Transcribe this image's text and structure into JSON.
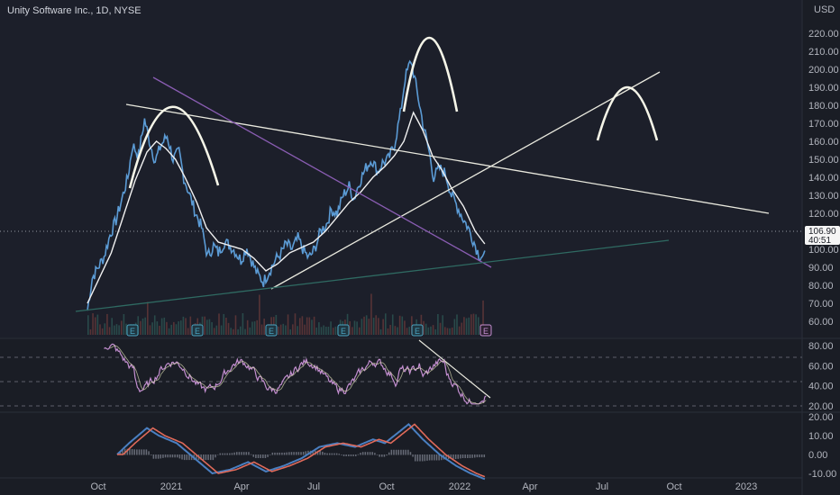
{
  "header": {
    "title": "Unity Software Inc., 1D, NYSE",
    "currency": "USD"
  },
  "colors": {
    "background": "#1a1d25",
    "price": "#5b9bd5",
    "ma": "#f0f0f0",
    "grid": "#2a2e39",
    "volume": "#6b3b3b",
    "rsi": "#c48fd1",
    "rsi_ma": "#e0d090",
    "macd": "#4a7fc1",
    "signal": "#e06a5a",
    "hist": "#7a7f8c",
    "annotation": "#f5f5e8",
    "channel_purple": "#8a5db3",
    "channel_teal": "#2f6a62",
    "last_price_bg": "#f5f5f5"
  },
  "price_axis": {
    "ticks": [
      "60.00",
      "70.00",
      "80.00",
      "90.00",
      "100.00",
      "110.00",
      "120.00",
      "130.00",
      "140.00",
      "150.00",
      "160.00",
      "170.00",
      "180.00",
      "190.00",
      "200.00",
      "210.00",
      "220.00"
    ]
  },
  "last_price": {
    "value": "106.90",
    "countdown": "40:51"
  },
  "rsi_axis": {
    "ticks": [
      "20.00",
      "40.00",
      "60.00",
      "80.00"
    ]
  },
  "macd_axis": {
    "ticks": [
      "-10.00",
      "0.00",
      "10.00",
      "20.00"
    ]
  },
  "time_axis": {
    "labels": [
      "Oct",
      "2021",
      "Apr",
      "Jul",
      "Oct",
      "2022",
      "Apr",
      "Jul",
      "Oct",
      "2023"
    ]
  },
  "earnings_markers": [
    "E",
    "E",
    "E",
    "E",
    "E",
    "E"
  ],
  "chart_data": {
    "type": "line",
    "title": "Unity Software Inc., 1D, NYSE",
    "ylabel": "USD",
    "ylim": [
      55,
      222
    ],
    "series": [
      {
        "values": [
          [
            0,
            66
          ],
          [
            4,
            84
          ],
          [
            9,
            90
          ],
          [
            14,
            96
          ],
          [
            19,
            108
          ],
          [
            24,
            116
          ],
          [
            29,
            128
          ],
          [
            34,
            140
          ],
          [
            38,
            158
          ],
          [
            43,
            152
          ],
          [
            48,
            172
          ],
          [
            53,
            158
          ],
          [
            57,
            149
          ],
          [
            62,
            158
          ],
          [
            67,
            163
          ],
          [
            72,
            150
          ],
          [
            77,
            154
          ],
          [
            81,
            140
          ],
          [
            86,
            130
          ],
          [
            91,
            120
          ],
          [
            96,
            112
          ],
          [
            101,
            96
          ],
          [
            106,
            102
          ],
          [
            110,
            98
          ],
          [
            115,
            104
          ],
          [
            120,
            102
          ],
          [
            124,
            99
          ],
          [
            129,
            94
          ],
          [
            134,
            101
          ],
          [
            139,
            92
          ],
          [
            143,
            86
          ],
          [
            148,
            82
          ],
          [
            153,
            88
          ],
          [
            158,
            94
          ],
          [
            163,
            98
          ],
          [
            167,
            103
          ],
          [
            172,
            100
          ],
          [
            177,
            106
          ],
          [
            182,
            99
          ],
          [
            186,
            95
          ],
          [
            191,
            100
          ],
          [
            196,
            110
          ],
          [
            201,
            114
          ],
          [
            205,
            122
          ],
          [
            210,
            120
          ],
          [
            215,
            130
          ],
          [
            220,
            135
          ],
          [
            224,
            128
          ],
          [
            229,
            138
          ],
          [
            234,
            145
          ],
          [
            239,
            150
          ],
          [
            244,
            143
          ],
          [
            248,
            148
          ],
          [
            253,
            150
          ],
          [
            258,
            158
          ],
          [
            263,
            175
          ],
          [
            267,
            195
          ],
          [
            272,
            205
          ],
          [
            277,
            188
          ],
          [
            282,
            170
          ],
          [
            287,
            155
          ],
          [
            291,
            140
          ],
          [
            296,
            145
          ],
          [
            301,
            142
          ],
          [
            306,
            130
          ],
          [
            310,
            125
          ],
          [
            315,
            118
          ],
          [
            320,
            112
          ],
          [
            325,
            104
          ],
          [
            329,
            97
          ],
          [
            334,
            96
          ]
        ]
      },
      {
        "values": [
          [
            0,
            70
          ],
          [
            10,
            84
          ],
          [
            20,
            98
          ],
          [
            30,
            118
          ],
          [
            40,
            138
          ],
          [
            50,
            154
          ],
          [
            58,
            160
          ],
          [
            66,
            156
          ],
          [
            74,
            150
          ],
          [
            82,
            140
          ],
          [
            92,
            126
          ],
          [
            100,
            112
          ],
          [
            110,
            104
          ],
          [
            120,
            102
          ],
          [
            130,
            100
          ],
          [
            140,
            95
          ],
          [
            150,
            88
          ],
          [
            160,
            92
          ],
          [
            170,
            98
          ],
          [
            180,
            101
          ],
          [
            190,
            104
          ],
          [
            200,
            110
          ],
          [
            210,
            118
          ],
          [
            220,
            126
          ],
          [
            230,
            132
          ],
          [
            240,
            140
          ],
          [
            250,
            146
          ],
          [
            258,
            152
          ],
          [
            266,
            160
          ],
          [
            274,
            176
          ],
          [
            282,
            166
          ],
          [
            290,
            152
          ],
          [
            298,
            144
          ],
          [
            306,
            134
          ],
          [
            316,
            124
          ],
          [
            326,
            110
          ],
          [
            334,
            103
          ]
        ]
      }
    ]
  }
}
